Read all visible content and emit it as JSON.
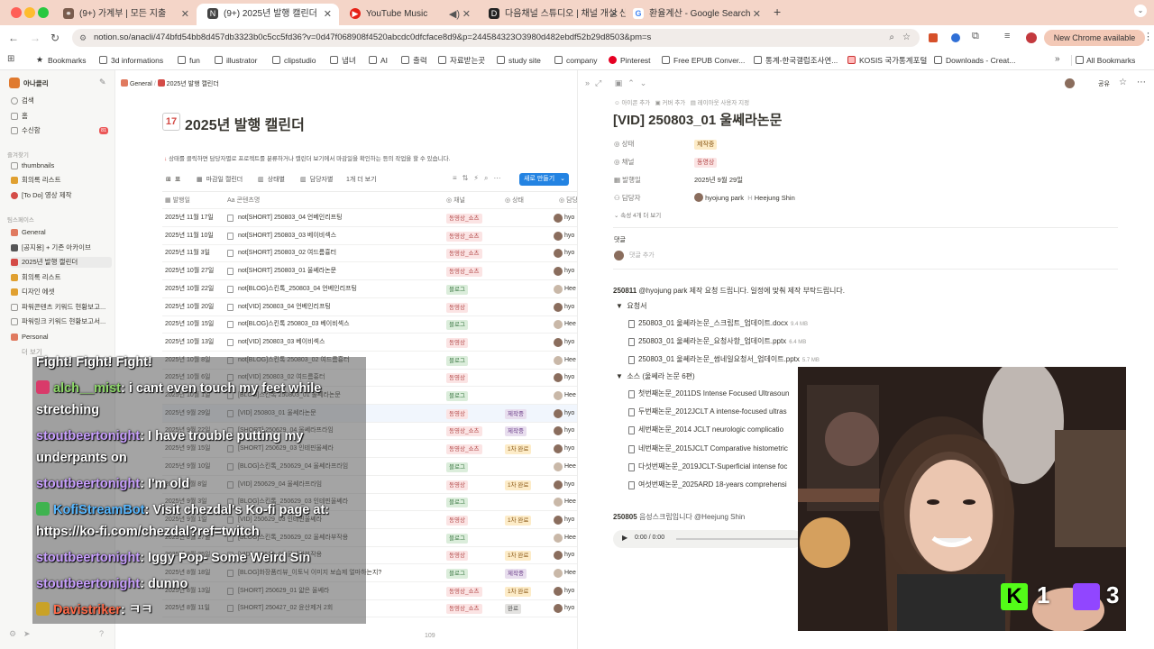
{
  "browser": {
    "tabs": [
      {
        "label": "(9+) 가계부 | 모든 지출",
        "icon_color": "#7a5c4d",
        "icon_text": "⚭"
      },
      {
        "label": "(9+) 2025년 발행 캘린더",
        "icon_color": "#555555",
        "icon_text": "N"
      },
      {
        "label": "YouTube Music",
        "icon_color": "#e62117",
        "icon_text": "▶"
      },
      {
        "label": "다음채널 스튜디오 | 채널 개설 신청",
        "icon_color": "#222222",
        "icon_text": "D"
      },
      {
        "label": "환율계산 - Google Search",
        "icon_color": "#4285f4",
        "icon_text": "G"
      }
    ],
    "new_tab": "+",
    "url": "notion.so/anacli/474bfd54bb8d457db3323b0c5cc5fd36?v=0d47f068908f4520abcdc0dfcface8d9&p=244584323O3980d482ebdf52b29d8503&pm=s",
    "new_chrome": "New Chrome available",
    "bookmarks": [
      "Bookmarks",
      "3d informations",
      "fun",
      "illustrator",
      "clipstudio",
      "냅녀",
      "AI",
      "출력",
      "자료받는곳",
      "study site",
      "company",
      "Pinterest",
      "Free EPUB Conver...",
      "통계-한국갤럽조사연...",
      "KOSIS 국가통계포털",
      "Downloads - Creat..."
    ],
    "all_bookmarks": "All Bookmarks"
  },
  "sidebar": {
    "workspace": "아나클리",
    "items": [
      {
        "label": "검색",
        "color": "#9b9a97"
      },
      {
        "label": "홈",
        "color": "#9b9a97"
      },
      {
        "label": "수신함",
        "color": "#9b9a97"
      }
    ],
    "inbox_badge": "81",
    "fav_header": "즐겨찾기",
    "favs": [
      {
        "label": "thumbnails",
        "color": "#9b9a97"
      },
      {
        "label": "회의록 리스트",
        "color": "#e0a030"
      },
      {
        "label": "[To Do] 영상 제작",
        "color": "#d44c47"
      }
    ],
    "team_header": "팀스페이스",
    "team": [
      {
        "label": "General",
        "color": "#e07a5f"
      },
      {
        "label": "[공지용] + 기존 아카이브",
        "color": "#555555"
      },
      {
        "label": "2025년 발행 캘린더",
        "color": "#d44c47"
      },
      {
        "label": "회의록 리스트",
        "color": "#e0a030"
      },
      {
        "label": "디자인 에셋",
        "color": "#e0a030"
      },
      {
        "label": "파워콘텐츠 키워드 현황보고...",
        "color": "#9b9a97"
      },
      {
        "label": "파워링크 키워드 현황보고서...",
        "color": "#9b9a97"
      },
      {
        "label": "Personal",
        "color": "#e07a5f"
      },
      {
        "label": "더 보기",
        "color": "#f7f7f5"
      }
    ]
  },
  "main": {
    "breadcrumb": [
      "General",
      "2025년 발행 캘린더"
    ],
    "title": "2025년 발행 캘린더",
    "desc": "상태를 클릭하면 담당자별로 프로젝트를 분류하거나 캘린더 보기에서 마감일을 확인하는 등의 작업을 할 수 있습니다.",
    "views": [
      "표",
      "마감일 캘린더",
      "상태별",
      "담당자별",
      "1개 더 보기"
    ],
    "new_button": "새로 만들기",
    "columns": [
      "발행일",
      "콘텐츠명",
      "채널",
      "상태",
      "담당"
    ],
    "rows": [
      {
        "date": "2025년 11월 17일",
        "name": "not[SHORT] 250803_04 언베인리프팅",
        "channel": "동영상_쇼츠",
        "status": "",
        "person": "hyo"
      },
      {
        "date": "2025년 11월 10일",
        "name": "not[SHORT] 250803_03 베이비섹스",
        "channel": "동영상_쇼츠",
        "status": "",
        "person": "hyo"
      },
      {
        "date": "2025년 11월 3일",
        "name": "not[SHORT] 250803_02 여드름흉터",
        "channel": "동영상_쇼츠",
        "status": "",
        "person": "hyo"
      },
      {
        "date": "2025년 10월 27일",
        "name": "not[SHORT] 250803_01 울쎄라논문",
        "channel": "동영상_쇼츠",
        "status": "",
        "person": "hyo"
      },
      {
        "date": "2025년 10월 22일",
        "name": "not[BLOG]스킨톡_250803_04 언베인리프팅",
        "channel": "블로그",
        "status": "",
        "person": "Hee"
      },
      {
        "date": "2025년 10월 20일",
        "name": "not[VID] 250803_04 언베인리프팅",
        "channel": "동영상",
        "status": "",
        "person": "hyo"
      },
      {
        "date": "2025년 10월 15일",
        "name": "not[BLOG]스킨톡 250803_03 베이비섹스",
        "channel": "블로그",
        "status": "",
        "person": "Hee"
      },
      {
        "date": "2025년 10월 13일",
        "name": "not[VID] 250803_03 베이비섹스",
        "channel": "동영상",
        "status": "",
        "person": "hyo"
      },
      {
        "date": "2025년 10월 8일",
        "name": "not[BLOG]스킨톡 250803_02 여드름흉터",
        "channel": "블로그",
        "status": "",
        "person": "Hee"
      },
      {
        "date": "2025년 10월 6일",
        "name": "not[VID] 250803_02 여드름흉터",
        "channel": "동영상",
        "status": "",
        "person": "hyo"
      },
      {
        "date": "2025년 10월 1일",
        "name": "[BLOG]스킨톡 250803_01 울쎄라논문",
        "channel": "블로그",
        "status": "",
        "person": "Hee"
      },
      {
        "date": "2025년 9월 29일",
        "name": "[VID] 250803_01 울쎄라논문",
        "channel": "동영상",
        "status": "제작중",
        "person": "hyo"
      },
      {
        "date": "2025년 9월 22일",
        "name": "[SHORT] 250629_04 울쎄라프라임",
        "channel": "동영상_쇼츠",
        "status": "제작중",
        "person": "hyo"
      },
      {
        "date": "2025년 9월 15일",
        "name": "[SHORT] 250629_03 인테핀울쎄라",
        "channel": "동영상_쇼츠",
        "status": "1차 완료",
        "person": "hyo"
      },
      {
        "date": "2025년 9월 10일",
        "name": "[BLOG]스킨톡_250629_04 울쎄라프라임",
        "channel": "블로그",
        "status": "",
        "person": "Hee"
      },
      {
        "date": "2025년 9월 8일",
        "name": "[VID] 250629_04 울쎄라프라임",
        "channel": "동영상",
        "status": "1차 완료",
        "person": "hyo"
      },
      {
        "date": "2025년 9월 3일",
        "name": "[BLOG]스킨톡_250629_03 인테핀울쎄라",
        "channel": "블로그",
        "status": "",
        "person": "Hee"
      },
      {
        "date": "2025년 9월 1일",
        "name": "[VID] 250629_03 인테핀울쎄라",
        "channel": "동영상",
        "status": "1차 완료",
        "person": "hyo"
      },
      {
        "date": "2025년 8월 27일",
        "name": "[BLOG]스킨톡_250629_02 울쎄라부작용",
        "channel": "블로그",
        "status": "",
        "person": "Hee"
      },
      {
        "date": "2025년 8월 25일",
        "name": "[VID] 250629_02 울쎄라부작용",
        "channel": "동영상",
        "status": "1차 완료",
        "person": "hyo"
      },
      {
        "date": "2025년 8월 18일",
        "name": "[BLOG]화장품리뷰_이토닉 이미지 보습제 얼마하는지?",
        "channel": "블로그",
        "status": "제작중",
        "person": "Hee"
      },
      {
        "date": "2025년 8월 13일",
        "name": "[SHORT] 250629_01 얇은 울쎄라",
        "channel": "동영상_쇼츠",
        "status": "1차 완료",
        "person": "hyo"
      },
      {
        "date": "2025년 8월 11일",
        "name": "[SHORT] 250427_02 윤산제거 2회",
        "channel": "동영상_쇼츠",
        "status": "완료",
        "person": "hyo"
      }
    ],
    "count_label": "109"
  },
  "panel": {
    "top_actions": [
      "아이콘 추가",
      "커버 추가",
      "레이아웃 사용자 지정"
    ],
    "share": "공유",
    "title": "[VID] 250803_01 울쎄라논문",
    "props": [
      {
        "label": "상태",
        "value": "제작중",
        "tag_bg": "#fdecc8",
        "tag_fg": "#8c5a18"
      },
      {
        "label": "채널",
        "value": "동영상",
        "tag_bg": "#fbe4e4",
        "tag_fg": "#b44a4a"
      },
      {
        "label": "발행일",
        "value": "2025년 9월 29일"
      }
    ],
    "assignee_label": "담당자",
    "assignees": [
      "hyojung park",
      "Heejung Shin"
    ],
    "more_props": "속성 4개 더 보기",
    "comments_label": "댓글",
    "comment_placeholder": "댓글 추가",
    "note1_date": "250811",
    "note1_text": "@hyojung park 제작 요청 드립니다. 일정에 맞춰 제작 부탁드립니다.",
    "req_header": "요청서",
    "req_files": [
      {
        "name": "250803_01 울쎄라논문_스크립트_업데이트.docx",
        "size": "9.4 MB"
      },
      {
        "name": "250803_01 울쎄라논문_요청사항_업데이트.pptx",
        "size": "6.4 MB"
      },
      {
        "name": "250803_01 울쎄라논문_썸네일요청서_업데이트.pptx",
        "size": "5.7 MB"
      }
    ],
    "src_header": "소스 (울쎄라 논문 6편)",
    "src_files": [
      "첫번째논문_2011DS Intense Focused Ultrasoun",
      "두번째논문_2012JCLT A intense-focused ultras",
      "세번째논문_2014 JCLT  neurologic complicatio",
      "네번째논문_2015JCLT Comparative histometric",
      "다섯번째논문_2019JCLT-Superficial intense foc",
      "여섯번째논문_2025ARD 18-years comprehensi"
    ],
    "note2_date": "250805",
    "note2_text": "음성스크립입니다 @Heejung Shin",
    "audio_time": "0:00 / 0:00"
  },
  "chat": {
    "lines": [
      {
        "user": "",
        "text": "Fight! Fight! Fight!",
        "cls": ""
      },
      {
        "user": "alch__mist",
        "text": ": i cant even touch my feet while",
        "cls": "u2",
        "badge": "#d93a6a"
      },
      {
        "user": "",
        "text": "stretching",
        "cls": ""
      },
      {
        "user": "stoutbeertonight",
        "text": ": I have trouble putting my",
        "cls": "u"
      },
      {
        "user": "",
        "text": "underpants on",
        "cls": ""
      },
      {
        "user": "stoutbeertonight",
        "text": ": I'm old",
        "cls": "u"
      },
      {
        "user": "KofiStreamBot",
        "text": ": Visit chezdal's Ko-fi page at:",
        "cls": "u3",
        "badge": "#3fb34f"
      },
      {
        "user": "",
        "text": "https://ko-fi.com/chezdal?ref=twitch",
        "cls": ""
      },
      {
        "user": "stoutbeertonight",
        "text": ": Iggy Pop- Some Weird Sin",
        "cls": "u"
      },
      {
        "user": "stoutbeertonight",
        "text": ": dunno",
        "cls": "u"
      },
      {
        "user": "Davistriker",
        "text": ": ㅋㅋ",
        "cls": "u4",
        "badge": "#c9a227"
      }
    ]
  },
  "cam": {
    "kick_count": "1",
    "twitch_count": "3"
  }
}
